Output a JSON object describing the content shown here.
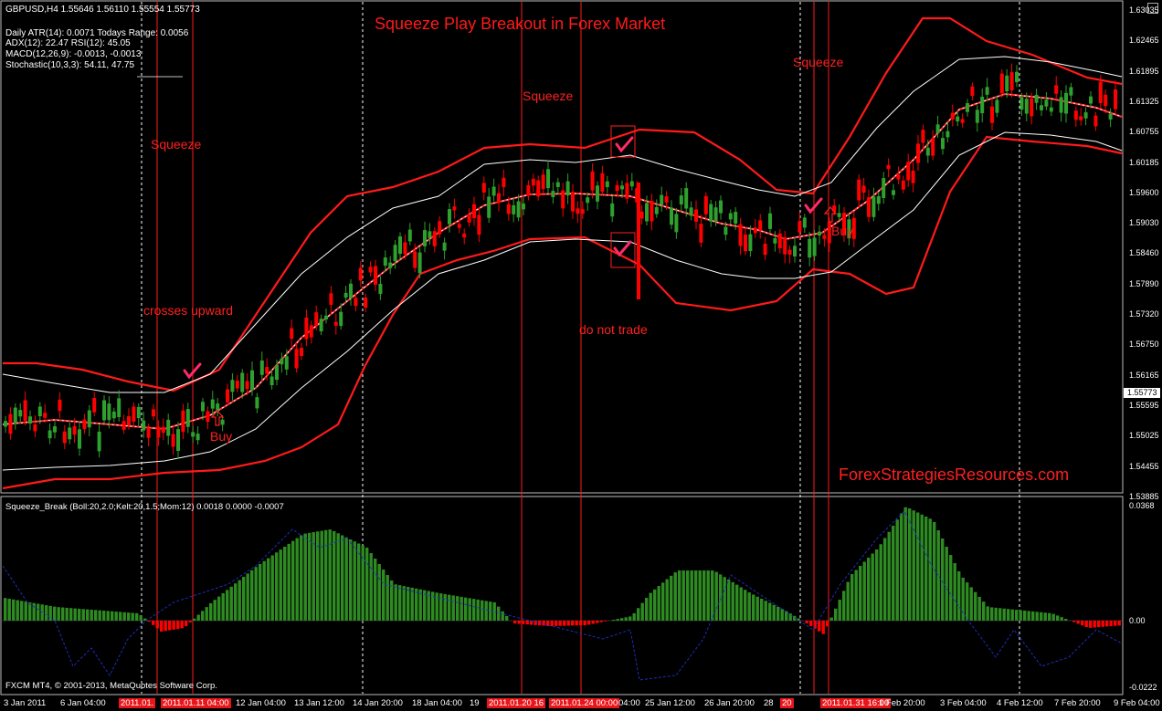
{
  "header": {
    "symbol_line": "GBPUSD,H4  1.55646 1.56110 1.55554 1.55773",
    "stats": [
      "Daily ATR(14): 0.0071 Todays Range: 0.0056",
      "ADX(12): 22.47 RSI(12): 45.05",
      "MACD(12,26,9): -0.0013, -0.0013",
      "Stochastic(10,3,3): 54.11, 47.75"
    ]
  },
  "title": "Squeeze Play Breakout in Forex Market",
  "annotations": {
    "squeeze_1": "Squeeze",
    "squeeze_2": "Squeeze",
    "squeeze_3": "Squeeze",
    "crosses_upward": "crosses upward",
    "buy_1": "Buy",
    "buy_2": "Buy",
    "do_not_trade": "do not trade"
  },
  "watermark": "ForexStrategiesResources.com",
  "price_axis": [
    "1.63035",
    "1.62465",
    "1.61895",
    "1.61325",
    "1.60755",
    "1.60185",
    "1.59600",
    "1.59030",
    "1.58460",
    "1.57890",
    "1.57320",
    "1.56750",
    "1.56165",
    "1.55595",
    "1.55025",
    "1.54455",
    "1.53885"
  ],
  "current_price": "1.55773",
  "indicator": {
    "label": "Squeeze_Break (Boll:20,2.0;Kelt:20,1.5;Mom:12) 0.0018 0.0000 -0.0007",
    "axis": [
      "0.0368",
      "0.00",
      "-0.0222"
    ]
  },
  "time_axis": [
    {
      "t": "3 Jan 2011",
      "hl": false
    },
    {
      "t": "6 Jan 04:00",
      "hl": false
    },
    {
      "t": "2011.01.",
      "hl": true
    },
    {
      "t": "2011.01.11 04:00",
      "hl": true
    },
    {
      "t": "12 Jan 04:00",
      "hl": false
    },
    {
      "t": "13 Jan 12:00",
      "hl": false
    },
    {
      "t": "14 Jan 20:00",
      "hl": false
    },
    {
      "t": "18 Jan 04:00",
      "hl": false
    },
    {
      "t": "19",
      "hl": false
    },
    {
      "t": "2011.01.20 16",
      "hl": true
    },
    {
      "t": "2011.01.24 00:00",
      "hl": true
    },
    {
      "t": "04:00",
      "hl": false
    },
    {
      "t": "25 Jan 12:00",
      "hl": false
    },
    {
      "t": "26 Jan 20:00",
      "hl": false
    },
    {
      "t": "28",
      "hl": false
    },
    {
      "t": "20",
      "hl": true
    },
    {
      "t": "2011.01.31 16:00",
      "hl": true
    },
    {
      "t": "1 Feb 20:00",
      "hl": false
    },
    {
      "t": "3 Feb 04:00",
      "hl": false
    },
    {
      "t": "4 Feb 12:00",
      "hl": false
    },
    {
      "t": "7 Feb 20:00",
      "hl": false
    },
    {
      "t": "9 Feb 04:00",
      "hl": false
    }
  ],
  "footer": "FXCM MT4, © 2001-2013, MetaQuotes Software Corp.",
  "colors": {
    "bull": "#2ea02e",
    "bear": "#ff0000",
    "band": "#ff1a1a",
    "keltner": "#ffffff",
    "momentum_pos": "#2e8b22",
    "momentum_neg": "#ff0000",
    "signal": "#1c2fb8"
  }
}
